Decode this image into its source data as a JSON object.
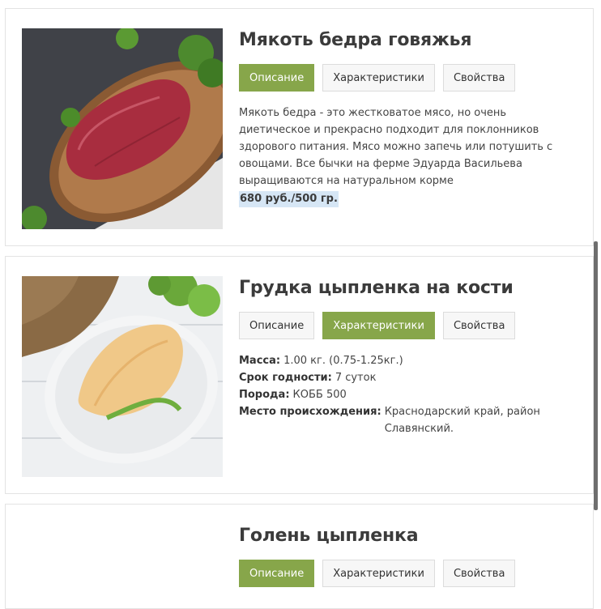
{
  "products": [
    {
      "title": "Мякоть бедра говяжья",
      "tabs": [
        "Описание",
        "Характеристики",
        "Свойства"
      ],
      "active_tab": 0,
      "description": "Мякоть бедра - это жестковатое мясо, но очень диетическое и прекрасно подходит для поклонников здорового питания. Мясо можно запечь или потушить с овощами. Все бычки на ферме Эдуарда Васильева выращиваются на натуральном корме",
      "price": "680 руб./500 гр.",
      "image": "beef-thigh-on-wooden-board"
    },
    {
      "title": "Грудка цыпленка на кости",
      "tabs": [
        "Описание",
        "Характеристики",
        "Свойства"
      ],
      "active_tab": 1,
      "specs": [
        {
          "key": "Масса:",
          "value": "1.00 кг. (0.75-1.25кг.)"
        },
        {
          "key": "Срок годности:",
          "value": "7 суток"
        },
        {
          "key": "Порода:",
          "value": "КОББ 500"
        },
        {
          "key": "Место происхождения:",
          "value": "Краснодарский край, район Славянский."
        }
      ],
      "image": "chicken-breast-on-white-plate"
    },
    {
      "title": "Голень цыпленка",
      "tabs": [
        "Описание",
        "Характеристики",
        "Свойства"
      ],
      "active_tab": 0
    }
  ],
  "colors": {
    "accent": "#87a64a",
    "price_highlight": "#d6e6f5"
  }
}
